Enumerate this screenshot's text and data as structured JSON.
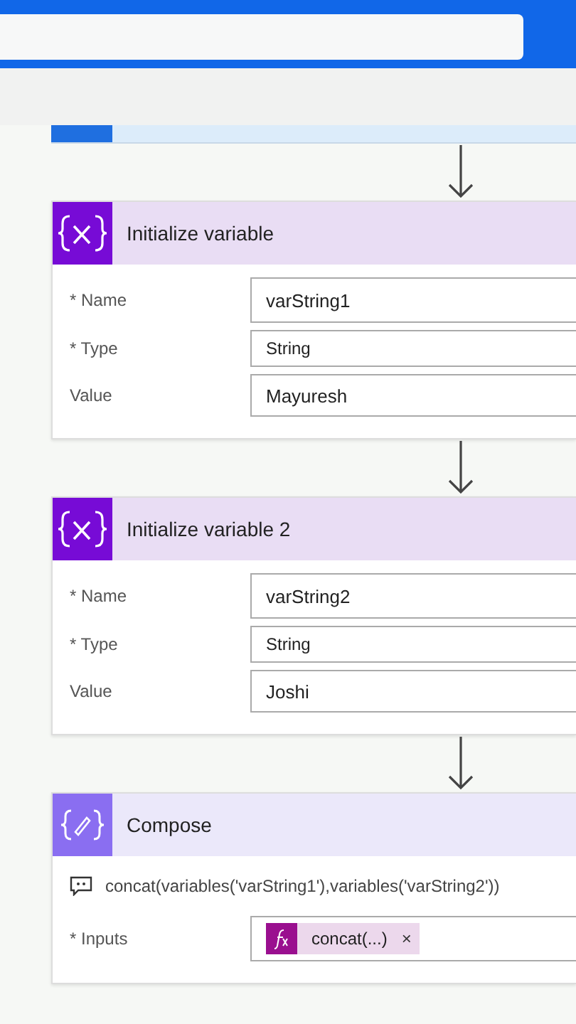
{
  "top_bar": {
    "search": {
      "kind": "field"
    }
  },
  "steps": [
    {
      "kind": "partial"
    },
    {
      "kind": "variable",
      "title": "Initialize variable",
      "fields": [
        {
          "label": "* Name",
          "value": "varString1",
          "kind": "text"
        },
        {
          "label": "* Type",
          "value": "String",
          "kind": "dropdown"
        },
        {
          "label": "Value",
          "value": "Mayuresh",
          "kind": "text"
        }
      ]
    },
    {
      "kind": "variable",
      "title": "Initialize variable 2",
      "fields": [
        {
          "label": "* Name",
          "value": "varString2",
          "kind": "text"
        },
        {
          "label": "* Type",
          "value": "String",
          "kind": "dropdown"
        },
        {
          "label": "Value",
          "value": "Joshi",
          "kind": "text"
        }
      ]
    },
    {
      "kind": "compose",
      "title": "Compose",
      "comment": "concat(variables('varString1'),variables('varString2'))",
      "fields": [
        {
          "label": "* Inputs",
          "kind": "tokens",
          "tokens": [
            {
              "label": "concat(...)",
              "remove": "×"
            }
          ]
        }
      ]
    }
  ]
}
